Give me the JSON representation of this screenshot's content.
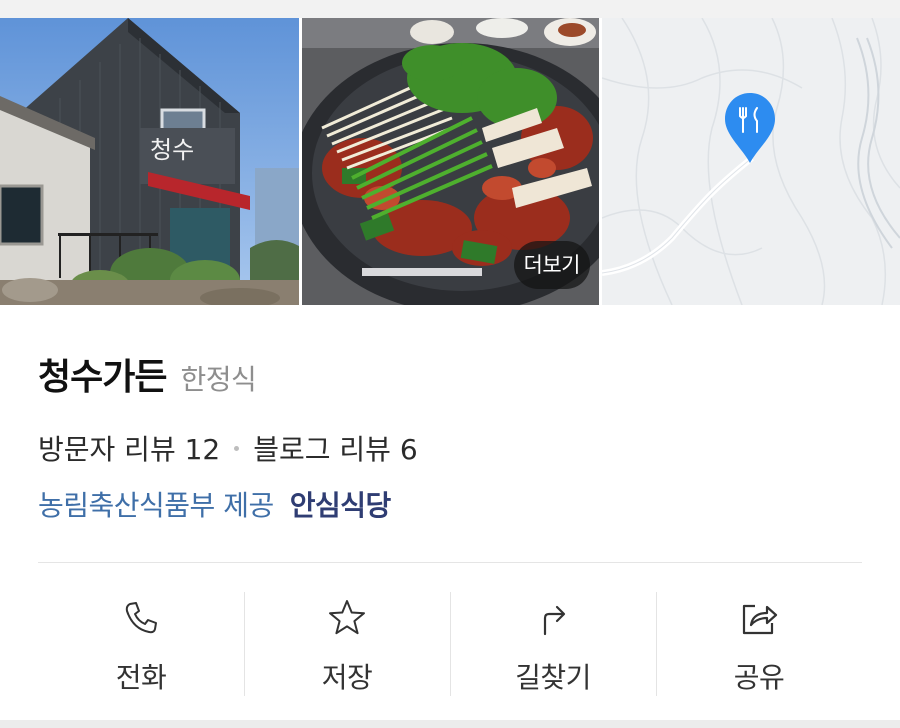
{
  "photos": {
    "more_label": "더보기"
  },
  "place": {
    "name": "청수가든",
    "category": "한정식"
  },
  "reviews": {
    "visitor": "방문자 리뷰 12",
    "blog": "블로그 리뷰 6"
  },
  "certification": {
    "provider": "농림축산식품부 제공",
    "badge": "안심식당"
  },
  "actions": [
    {
      "label": "전화",
      "icon": "phone-icon"
    },
    {
      "label": "저장",
      "icon": "star-icon"
    },
    {
      "label": "길찾기",
      "icon": "directions-icon"
    },
    {
      "label": "공유",
      "icon": "share-icon"
    }
  ],
  "colors": {
    "link_blue": "#3f6fa8",
    "badge_navy": "#2f3d73",
    "map_marker": "#2d8cf0"
  }
}
